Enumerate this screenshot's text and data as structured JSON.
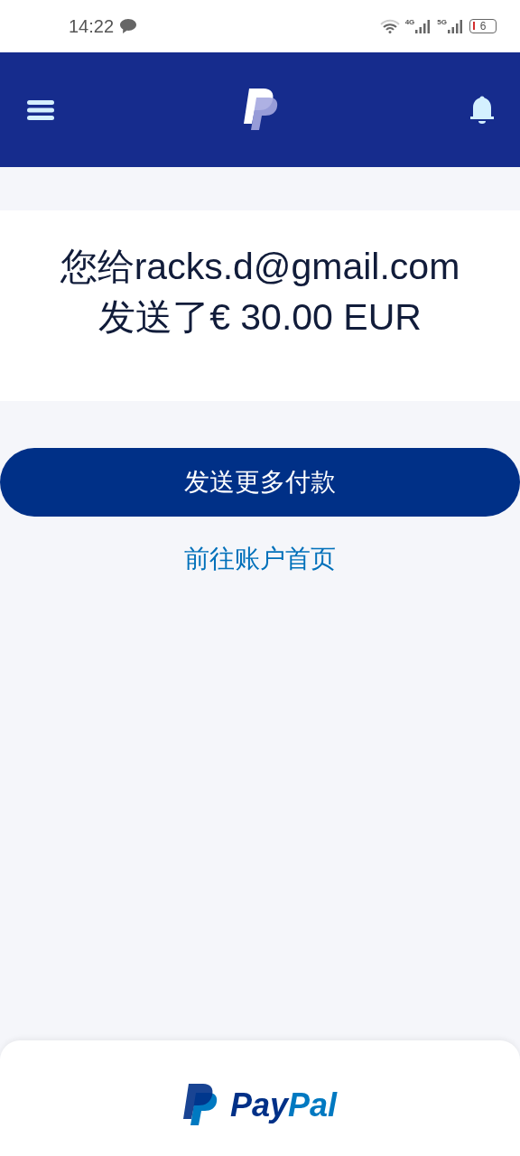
{
  "status_bar": {
    "time": "14:22",
    "network_1": "4G",
    "network_2": "5G",
    "battery": "6"
  },
  "message_lines": [
    "您给racks.d@gmail.com",
    "发送了€ 30.00 EUR"
  ],
  "primary_button": "发送更多付款",
  "link": "前往账户首页",
  "footer": {
    "brand_parts": [
      "Pay",
      "Pal"
    ]
  }
}
